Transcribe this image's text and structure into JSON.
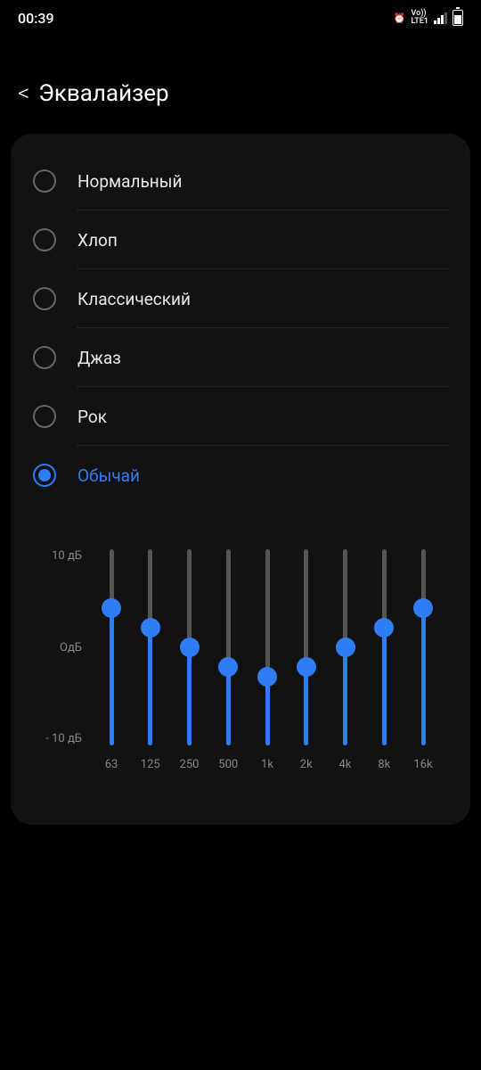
{
  "status": {
    "time": "00:39",
    "network": "LTE1",
    "vo": "Vo))"
  },
  "header": {
    "back": "<",
    "title": "Эквалайзер"
  },
  "presets": [
    {
      "label": "Нормальный",
      "selected": false
    },
    {
      "label": "Хлоп",
      "selected": false
    },
    {
      "label": "Классический",
      "selected": false
    },
    {
      "label": "Джаз",
      "selected": false
    },
    {
      "label": "Рок",
      "selected": false
    },
    {
      "label": "Обычай",
      "selected": true
    }
  ],
  "chart_data": {
    "type": "bar",
    "categories": [
      "63",
      "125",
      "250",
      "500",
      "1k",
      "2k",
      "4k",
      "8k",
      "16k"
    ],
    "values": [
      4,
      2,
      0,
      -2,
      -3,
      -2,
      0,
      2,
      4
    ],
    "xlabel": "",
    "ylabel": "",
    "ylim": [
      -10,
      10
    ],
    "y_ticks": [
      "10 дБ",
      "ОдБ",
      "- 10 дБ"
    ]
  },
  "colors": {
    "accent": "#2e7cf6"
  }
}
